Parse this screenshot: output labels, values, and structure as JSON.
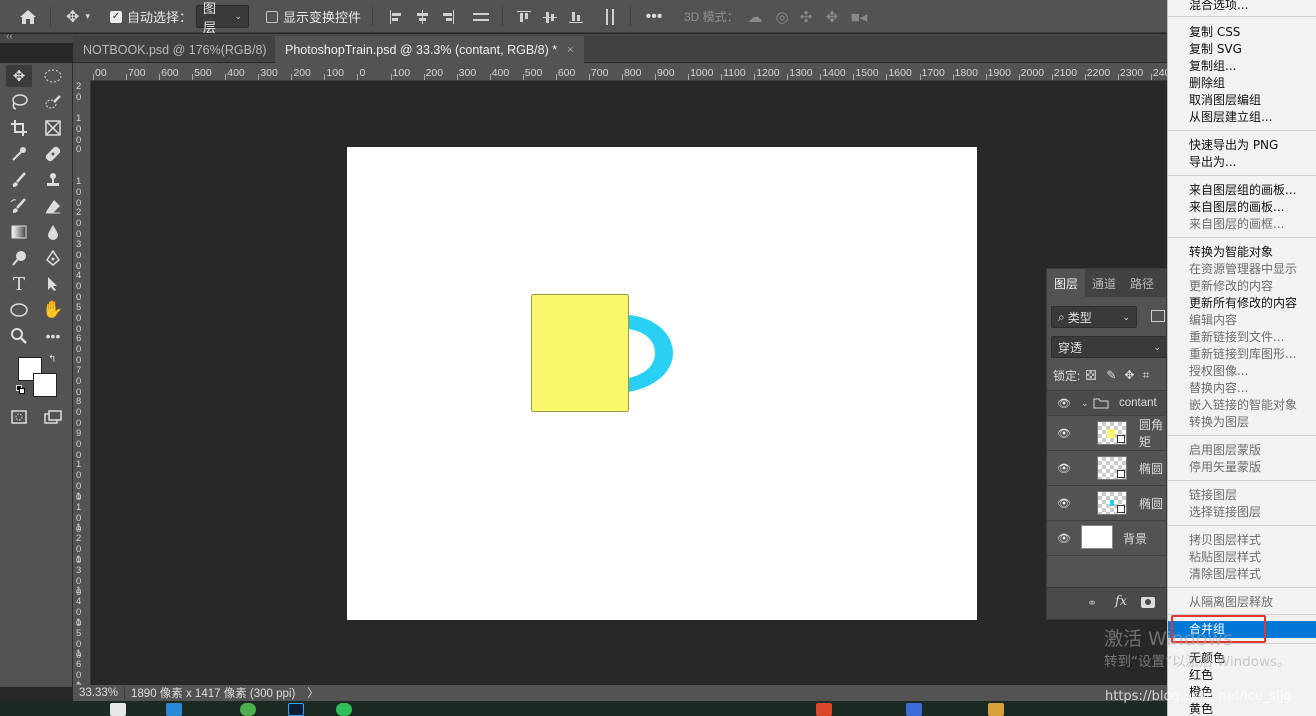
{
  "options_bar": {
    "auto_select_label": "自动选择：",
    "layer_select_value": "图层",
    "show_transform_label": "显示变换控件",
    "mode_3d_label": "3D 模式："
  },
  "tabs": [
    {
      "label": "NOTBOOK.psd @ 176%(RGB/8)",
      "close": "×"
    },
    {
      "label": "PhotoshopTrain.psd @ 33.3% (contant, RGB/8) *",
      "close": "×"
    }
  ],
  "ruler_h_ticks": [
    "00",
    "700",
    "600",
    "500",
    "400",
    "300",
    "200",
    "100",
    "0",
    "100",
    "200",
    "300",
    "400",
    "500",
    "600",
    "700",
    "800",
    "900",
    "1000",
    "1100",
    "1200",
    "1300",
    "1400",
    "1500",
    "1600",
    "1700",
    "1800",
    "1900",
    "2000",
    "2100",
    "2200",
    "2300",
    "240"
  ],
  "ruler_v_ticks": [
    "2\n0",
    "1\n0\n0",
    "0",
    "1\n0\n0",
    "2\n0\n0",
    "3\n0\n0",
    "4\n0\n0",
    "5\n0\n0",
    "6\n0\n0",
    "7\n0\n0",
    "8\n0\n0",
    "9\n0\n0",
    "1\n0\n0\n0",
    "1\n1\n0\n0",
    "1\n2\n0\n0",
    "1\n3\n0\n0",
    "1\n4\n0\n0",
    "1\n5\n0\n0",
    "1\n6\n0\n0",
    "1\n7\n0\n0"
  ],
  "canvas": {
    "rect_color": "#f9f76c",
    "handle_color": "#2ad0f3"
  },
  "status": {
    "zoom": "33.33%",
    "doc_info": "1890 像素 x 1417 像素 (300 ppi)",
    "arrow": "〉"
  },
  "layers_panel": {
    "tabs": [
      "图层",
      "通道",
      "路径"
    ],
    "filter_value": "类型",
    "blend_value": "穿透",
    "lock_label": "锁定:",
    "group_name": "contant",
    "layers": [
      {
        "name": "圆角矩"
      },
      {
        "name": "椭圆"
      },
      {
        "name": "椭圆"
      }
    ],
    "background_name": "背景",
    "fx_label": "fx"
  },
  "context_menu": {
    "items": [
      {
        "label": "混合选项...",
        "disabled": false
      },
      {
        "label": "复制 CSS",
        "disabled": false
      },
      {
        "label": "复制 SVG",
        "disabled": false
      },
      {
        "label": "复制组...",
        "disabled": false
      },
      {
        "label": "删除组",
        "disabled": false
      },
      {
        "label": "取消图层编组",
        "disabled": false
      },
      {
        "label": "从图层建立组...",
        "disabled": false
      },
      {
        "label": "快速导出为 PNG",
        "disabled": false
      },
      {
        "label": "导出为...",
        "disabled": false
      },
      {
        "label": "来自图层组的画板...",
        "disabled": false
      },
      {
        "label": "来自图层的画板...",
        "disabled": false
      },
      {
        "label": "来自图层的画框...",
        "disabled": true
      },
      {
        "label": "转换为智能对象",
        "disabled": false
      },
      {
        "label": "在资源管理器中显示",
        "disabled": true
      },
      {
        "label": "更新修改的内容",
        "disabled": true
      },
      {
        "label": "更新所有修改的内容",
        "disabled": false
      },
      {
        "label": "编辑内容",
        "disabled": true
      },
      {
        "label": "重新链接到文件...",
        "disabled": true
      },
      {
        "label": "重新链接到库图形...",
        "disabled": true
      },
      {
        "label": "授权图像...",
        "disabled": true
      },
      {
        "label": "替换内容...",
        "disabled": true
      },
      {
        "label": "嵌入链接的智能对象",
        "disabled": true
      },
      {
        "label": "转换为图层",
        "disabled": true
      },
      {
        "label": "启用图层蒙版",
        "disabled": true
      },
      {
        "label": "停用矢量蒙版",
        "disabled": true
      },
      {
        "label": "链接图层",
        "disabled": true
      },
      {
        "label": "选择链接图层",
        "disabled": true
      },
      {
        "label": "拷贝图层样式",
        "disabled": true
      },
      {
        "label": "粘贴图层样式",
        "disabled": true
      },
      {
        "label": "清除图层样式",
        "disabled": true
      },
      {
        "label": "从隔离图层释放",
        "disabled": true
      },
      {
        "label": "合并组",
        "disabled": false
      },
      {
        "label": "无颜色",
        "disabled": false
      },
      {
        "label": "红色",
        "disabled": false
      },
      {
        "label": "橙色",
        "disabled": false
      },
      {
        "label": "黄色",
        "disabled": false
      }
    ],
    "highlighted_index": 31
  },
  "watermark": {
    "line1": "激活 Windows",
    "line2": "转到“设置”以激活 Windows。",
    "url": "https://blog.csdn.net/ice_sljg"
  }
}
